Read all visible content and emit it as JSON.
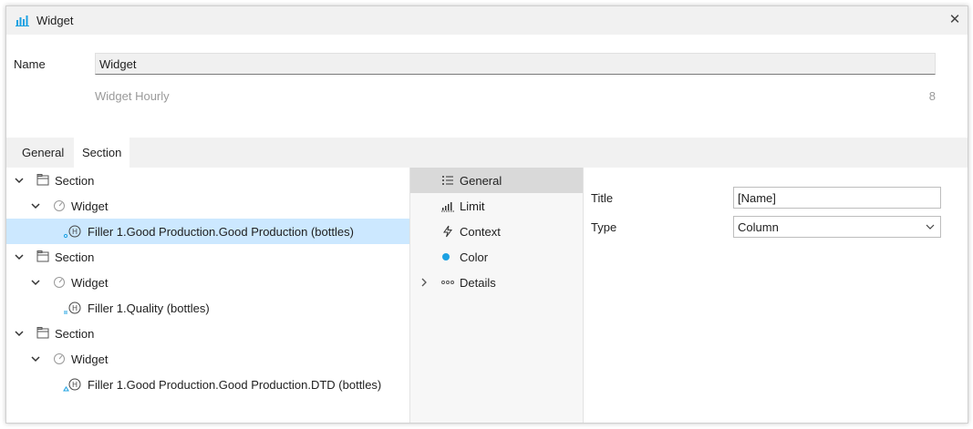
{
  "window": {
    "title": "Widget",
    "title_icon": "bar-chart-icon",
    "close_glyph": "✕"
  },
  "form": {
    "name_label": "Name",
    "name_value": "Widget",
    "subtitle": "Widget Hourly",
    "count": "8"
  },
  "tabs": [
    {
      "label": "General",
      "active": false
    },
    {
      "label": "Section",
      "active": true
    }
  ],
  "tree": [
    {
      "label": "Section",
      "icon": "section-icon",
      "expanded": true
    },
    {
      "label": "Widget",
      "icon": "gauge-icon",
      "expanded": true
    },
    {
      "label": "Filler 1.Good Production.Good Production (bottles)",
      "icon": "historian-tag-icon",
      "selected": true
    },
    {
      "label": "Section",
      "icon": "section-icon",
      "expanded": true
    },
    {
      "label": "Widget",
      "icon": "gauge-icon",
      "expanded": true
    },
    {
      "label": "Filler 1.Quality (bottles)",
      "icon": "historian-tag-icon"
    },
    {
      "label": "Section",
      "icon": "section-icon",
      "expanded": true
    },
    {
      "label": "Widget",
      "icon": "gauge-icon",
      "expanded": true
    },
    {
      "label": "Filler 1.Good Production.Good Production.DTD (bottles)",
      "icon": "historian-tag-icon"
    }
  ],
  "nav": [
    {
      "label": "General",
      "icon": "list-icon",
      "active": true
    },
    {
      "label": "Limit",
      "icon": "limit-icon"
    },
    {
      "label": "Context",
      "icon": "lightning-icon"
    },
    {
      "label": "Color",
      "icon": "color-dot-icon"
    },
    {
      "label": "Details",
      "icon": "dots-icon",
      "collapsible": true
    }
  ],
  "properties": {
    "title_label": "Title",
    "title_value": "[Name]",
    "type_label": "Type",
    "type_value": "Column"
  },
  "colors": {
    "accent": "#1ba1e2",
    "selection": "#cce8ff",
    "nav_active": "#d9d9d9"
  }
}
